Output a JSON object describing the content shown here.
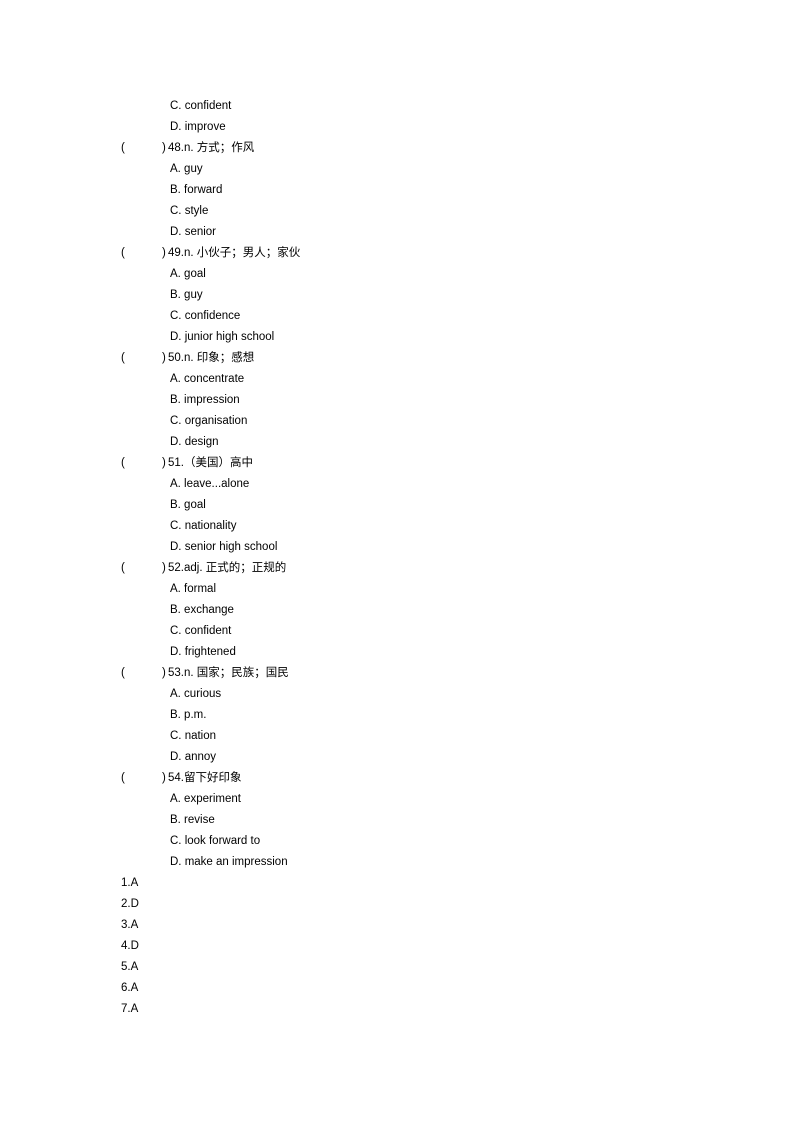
{
  "document": {
    "page_background": "#ffffff",
    "text_color": "#000000",
    "paren_open": "(",
    "paren_close": ")"
  },
  "leading_options": [
    {
      "text": "C. confident"
    },
    {
      "text": "D. improve"
    }
  ],
  "questions": [
    {
      "number": "48",
      "stem": "48.n. 方式；作风",
      "options": [
        "A. guy",
        "B. forward",
        "C. style",
        "D. senior"
      ]
    },
    {
      "number": "49",
      "stem": "49.n. 小伙子；男人；家伙",
      "options": [
        "A. goal",
        "B. guy",
        "C. confidence",
        "D. junior high school"
      ]
    },
    {
      "number": "50",
      "stem": "50.n. 印象；感想",
      "options": [
        "A. concentrate",
        "B. impression",
        "C. organisation",
        "D. design"
      ]
    },
    {
      "number": "51",
      "stem": "51.（美国）高中",
      "options": [
        "A. leave...alone",
        "B. goal",
        "C. nationality",
        "D. senior high school"
      ]
    },
    {
      "number": "52",
      "stem": "52.adj. 正式的；正规的",
      "options": [
        "A. formal",
        "B. exchange",
        "C. confident",
        "D. frightened"
      ]
    },
    {
      "number": "53",
      "stem": "53.n. 国家；民族；国民",
      "options": [
        "A. curious",
        "B. p.m.",
        "C. nation",
        "D. annoy"
      ]
    },
    {
      "number": "54",
      "stem": "54.留下好印象",
      "options": [
        "A. experiment",
        "B. revise",
        "C. look forward to",
        "D. make an impression"
      ]
    }
  ],
  "answer_key": [
    "1.A",
    "2.D",
    "3.A",
    "4.D",
    "5.A",
    "6.A",
    "7.A"
  ]
}
